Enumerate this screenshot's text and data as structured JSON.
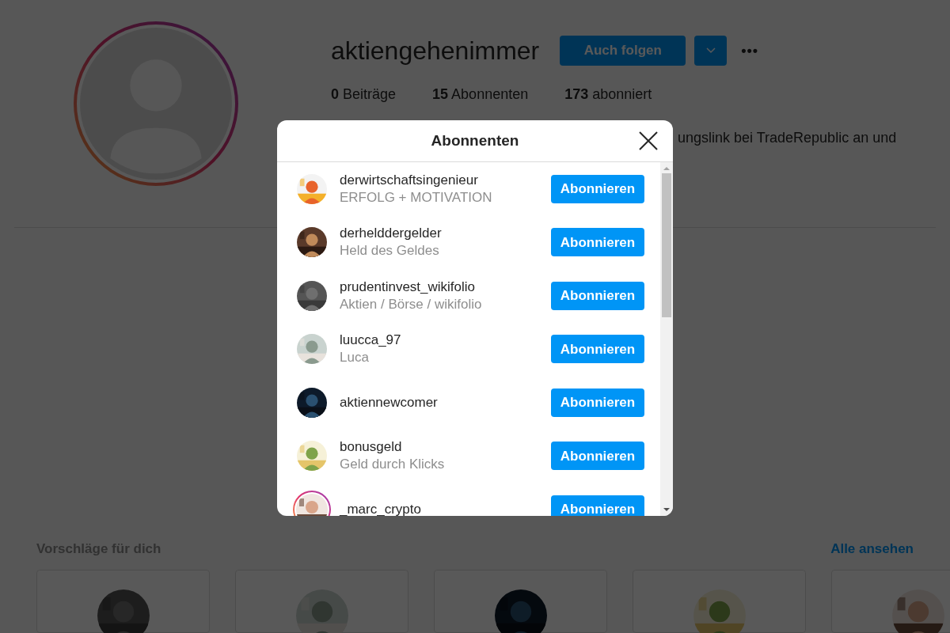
{
  "profile": {
    "username": "aktiengehenimmer",
    "follow_button": "Auch folgen",
    "more_icon": "•••",
    "stats": [
      {
        "count": "0",
        "label": "Beiträge"
      },
      {
        "count": "15",
        "label": "Abonnenten"
      },
      {
        "count": "173",
        "label": "abonniert"
      }
    ],
    "bio": "ungslink bei TradeRepublic an und"
  },
  "suggestions": {
    "title": "Vorschläge für dich",
    "see_all": "Alle ansehen"
  },
  "dialog": {
    "title": "Abonnenten",
    "followers": [
      {
        "username": "derwirtschaftsingenieur",
        "bio": "ERFOLG + MOTIVATION",
        "button": "Abonnieren",
        "story": false
      },
      {
        "username": "derhelddergelder",
        "bio": "Held des Geldes",
        "button": "Abonnieren",
        "story": false
      },
      {
        "username": "prudentinvest_wikifolio",
        "bio": "Aktien / Börse / wikifolio",
        "button": "Abonnieren",
        "story": false
      },
      {
        "username": "luucca_97",
        "bio": "Luca",
        "button": "Abonnieren",
        "story": false
      },
      {
        "username": "aktiennewcomer",
        "button": "Abonnieren",
        "story": false
      },
      {
        "username": "bonusgeld",
        "bio": "Geld durch Klicks",
        "button": "Abonnieren",
        "story": false
      },
      {
        "username": "_marc_crypto",
        "button": "Abonnieren",
        "story": true
      }
    ]
  }
}
